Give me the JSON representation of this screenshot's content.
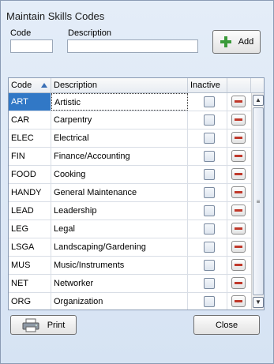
{
  "window": {
    "title": "Maintain Skills Codes"
  },
  "form": {
    "code_label": "Code",
    "description_label": "Description",
    "code_value": "",
    "description_value": "",
    "add_label": "Add"
  },
  "grid": {
    "headers": {
      "code": "Code",
      "description": "Description",
      "inactive": "Inactive"
    },
    "sort_column": "code",
    "sort_direction": "ascending",
    "rows": [
      {
        "code": "ART",
        "description": "Artistic",
        "inactive": false,
        "selected": true
      },
      {
        "code": "CAR",
        "description": "Carpentry",
        "inactive": false
      },
      {
        "code": "ELEC",
        "description": "Electrical",
        "inactive": false
      },
      {
        "code": "FIN",
        "description": "Finance/Accounting",
        "inactive": false
      },
      {
        "code": "FOOD",
        "description": "Cooking",
        "inactive": false
      },
      {
        "code": "HANDY",
        "description": "General Maintenance",
        "inactive": false
      },
      {
        "code": "LEAD",
        "description": "Leadership",
        "inactive": false
      },
      {
        "code": "LEG",
        "description": "Legal",
        "inactive": false
      },
      {
        "code": "LSGA",
        "description": "Landscaping/Gardening",
        "inactive": false
      },
      {
        "code": "MUS",
        "description": "Music/Instruments",
        "inactive": false
      },
      {
        "code": "NET",
        "description": "Networker",
        "inactive": false
      },
      {
        "code": "ORG",
        "description": "Organization",
        "inactive": false
      }
    ]
  },
  "footer": {
    "print_label": "Print",
    "close_label": "Close"
  },
  "icons": {
    "add": "plus-icon",
    "print": "printer-icon",
    "delete": "minus-icon",
    "sort": "sort-up-icon"
  },
  "colors": {
    "selection": "#3178c6",
    "add_plus": "#3a9a3a",
    "delete_minus": "#c0392b"
  }
}
